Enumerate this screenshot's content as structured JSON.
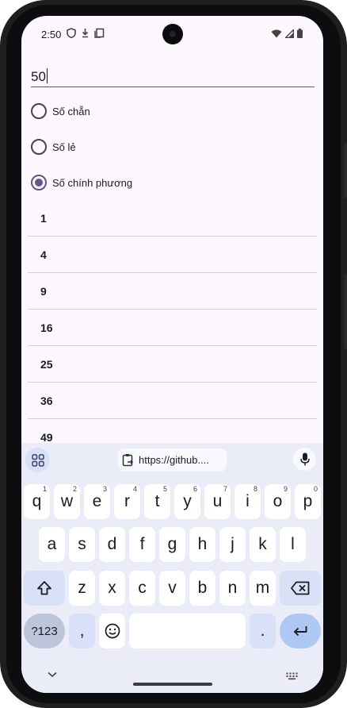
{
  "status_bar": {
    "time": "2:50",
    "icons_left": [
      "shield-icon",
      "download-icon",
      "clipboard-icon"
    ],
    "icons_right": [
      "wifi-icon",
      "signal-icon",
      "battery-icon"
    ]
  },
  "input": {
    "value": "50"
  },
  "filters": [
    {
      "label": "Số chẵn",
      "checked": false
    },
    {
      "label": "Số lẻ",
      "checked": false
    },
    {
      "label": "Số chính phương",
      "checked": true
    }
  ],
  "results": [
    "1",
    "4",
    "9",
    "16",
    "25",
    "36",
    "49"
  ],
  "keyboard": {
    "clipboard_suggestion": "https://github....",
    "row1": [
      {
        "label": "q",
        "hint": "1"
      },
      {
        "label": "w",
        "hint": "2"
      },
      {
        "label": "e",
        "hint": "3"
      },
      {
        "label": "r",
        "hint": "4"
      },
      {
        "label": "t",
        "hint": "5"
      },
      {
        "label": "y",
        "hint": "6"
      },
      {
        "label": "u",
        "hint": "7"
      },
      {
        "label": "i",
        "hint": "8"
      },
      {
        "label": "o",
        "hint": "9"
      },
      {
        "label": "p",
        "hint": "0"
      }
    ],
    "row2": [
      "a",
      "s",
      "d",
      "f",
      "g",
      "h",
      "j",
      "k",
      "l"
    ],
    "row3": [
      "z",
      "x",
      "c",
      "v",
      "b",
      "n",
      "m"
    ],
    "symbols_label": "?123",
    "comma_label": ",",
    "period_label": ".",
    "accent_color": "#65558f"
  }
}
